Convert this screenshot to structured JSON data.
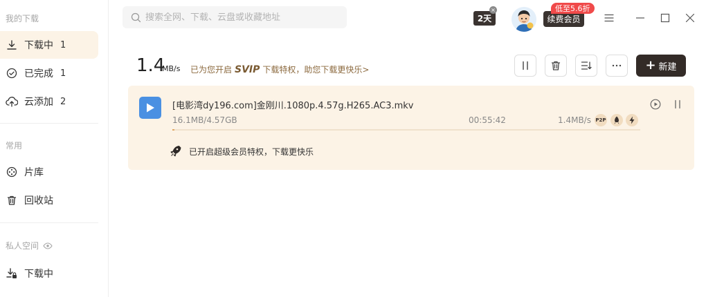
{
  "sidebar": {
    "section_downloads": "我的下载",
    "items_downloads": [
      {
        "label": "下载中",
        "count": "1"
      },
      {
        "label": "已完成",
        "count": "1"
      },
      {
        "label": "云添加",
        "count": "2"
      }
    ],
    "section_common": "常用",
    "items_common": [
      {
        "label": "片库"
      },
      {
        "label": "回收站"
      }
    ],
    "section_private": "私人空间",
    "items_private": [
      {
        "label": "下载中"
      }
    ]
  },
  "header": {
    "search_placeholder": "搜索全网、下载、云盘或收藏地址",
    "days_badge": "2天",
    "promo_badge": "低至5.6折",
    "renew_label": "续费会员"
  },
  "speed": {
    "value": "1.4",
    "unit": "MB/s",
    "svip_prefix": "已为您开启",
    "svip_label": "SVIP",
    "svip_suffix": "下载特权，助您下载更快乐>"
  },
  "toolbar": {
    "new_label": "新建"
  },
  "task": {
    "filename": "[电影湾dy196.com]金刚川.1080p.4.57g.H265.AC3.mkv",
    "size": "16.1MB/4.57GB",
    "remaining": "00:55:42",
    "speed": "1.4MB/s",
    "p2p_badge": "P2P",
    "progress_fraction": 0.0034,
    "promo_text": "已开启超级会员特权，下载更快乐"
  },
  "colors": {
    "accent_bg": "#fcf3e6",
    "dark_button": "#332b27",
    "file_icon": "#4a90e2",
    "promo_red": "#f04a4a",
    "progress": "#e0a764"
  }
}
